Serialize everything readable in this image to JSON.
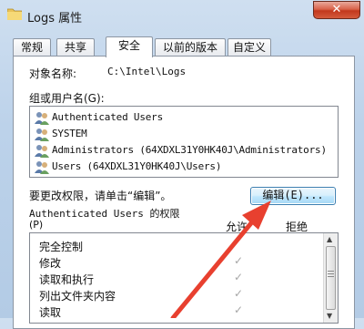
{
  "window": {
    "title": "Logs 属性",
    "close_label": "✕"
  },
  "tabs": [
    "常规",
    "共享",
    "安全",
    "以前的版本",
    "自定义"
  ],
  "object": {
    "label": "对象名称:",
    "value": "C:\\Intel\\Logs"
  },
  "groups": {
    "label": "组或用户名(G):",
    "users": [
      "Authenticated Users",
      "SYSTEM",
      "Administrators (64XDXL31Y0HK40J\\Administrators)",
      "Users (64XDXL31Y0HK40J\\Users)"
    ]
  },
  "edit": {
    "hint": "要更改权限，请单击“编辑”。",
    "button_label": "编辑(E)..."
  },
  "permissions": {
    "header_line1": "Authenticated Users 的权限",
    "header_line2": "(P)",
    "allow_label": "允许",
    "deny_label": "拒绝",
    "rows": [
      {
        "name": "完全控制",
        "allow": false
      },
      {
        "name": "修改",
        "allow": true,
        "check": "✓"
      },
      {
        "name": "读取和执行",
        "allow": true,
        "check": "✓"
      },
      {
        "name": "列出文件夹内容",
        "allow": true,
        "check": "✓"
      },
      {
        "name": "读取",
        "allow": true,
        "check": "✓"
      }
    ]
  },
  "colors": {
    "annotation_arrow": "#e8402f",
    "accent": "#3c7fb1"
  }
}
